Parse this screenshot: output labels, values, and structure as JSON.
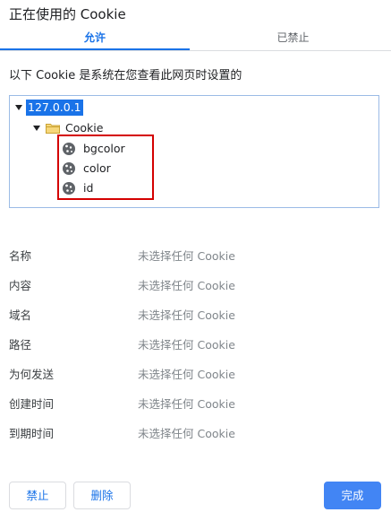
{
  "dialog": {
    "title": "正在使用的 Cookie"
  },
  "tabs": [
    {
      "label": "允许"
    },
    {
      "label": "已禁止"
    }
  ],
  "description": "以下 Cookie 是系统在您查看此网页时设置的",
  "tree": {
    "root": "127.0.0.1",
    "folder": "Cookie",
    "cookies": [
      "bgcolor",
      "color",
      "id"
    ]
  },
  "details": [
    {
      "label": "名称",
      "value": "未选择任何 Cookie"
    },
    {
      "label": "内容",
      "value": "未选择任何 Cookie"
    },
    {
      "label": "域名",
      "value": "未选择任何 Cookie"
    },
    {
      "label": "路径",
      "value": "未选择任何 Cookie"
    },
    {
      "label": "为何发送",
      "value": "未选择任何 Cookie"
    },
    {
      "label": "创建时间",
      "value": "未选择任何 Cookie"
    },
    {
      "label": "到期时间",
      "value": "未选择任何 Cookie"
    }
  ],
  "buttons": {
    "block": "禁止",
    "remove": "删除",
    "done": "完成"
  },
  "colors": {
    "accent": "#1a73e8",
    "primary_button": "#4285f4",
    "highlight_border": "#d40000"
  }
}
